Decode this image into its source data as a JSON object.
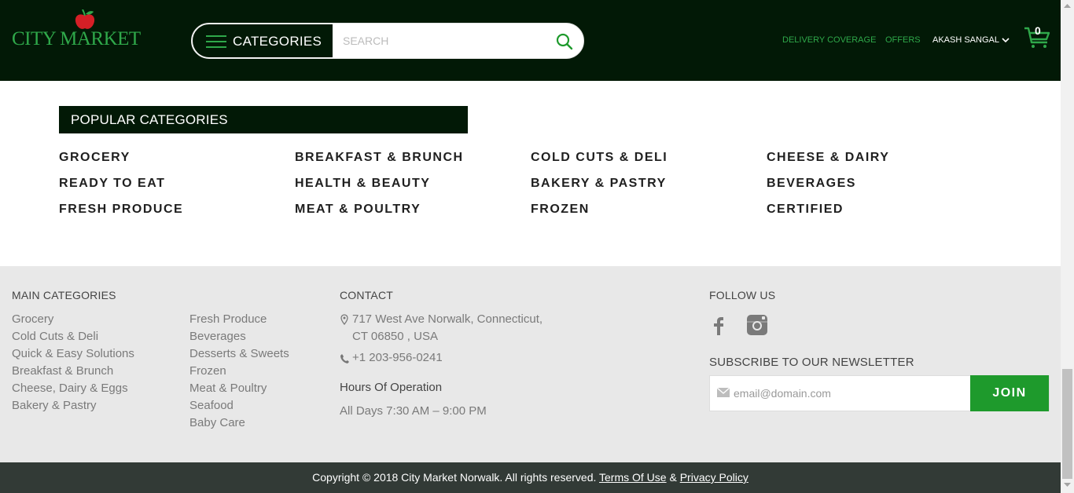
{
  "header": {
    "logo_text": "CITY MARKET",
    "categories_label": "CATEGORIES",
    "search_placeholder": "SEARCH",
    "nav": {
      "delivery": "DELIVERY COVERAGE",
      "offers": "OFFERS",
      "user": "AKASH SANGAL",
      "cart_count": "0"
    }
  },
  "popular": {
    "title": "POPULAR CATEGORIES",
    "columns": [
      [
        "GROCERY",
        "READY TO EAT",
        "FRESH PRODUCE"
      ],
      [
        "BREAKFAST & BRUNCH",
        "HEALTH & BEAUTY",
        "MEAT & POULTRY"
      ],
      [
        "COLD CUTS & DELI",
        "BAKERY & PASTRY",
        "FROZEN"
      ],
      [
        "CHEESE & DAIRY",
        "BEVERAGES",
        "CERTIFIED"
      ]
    ]
  },
  "footer": {
    "main_title": "MAIN CATEGORIES",
    "col1": [
      "Grocery",
      "Cold Cuts & Deli",
      "Quick & Easy Solutions",
      "Breakfast & Brunch",
      "Cheese, Dairy & Eggs",
      "Bakery & Pastry"
    ],
    "col2": [
      "Fresh Produce",
      "Beverages",
      "Desserts & Sweets",
      "Frozen",
      "Meat & Poultry",
      "Seafood",
      "Baby Care"
    ],
    "contact_title": "CONTACT",
    "address_line1": "717 West Ave Norwalk, Connecticut,",
    "address_line2": "CT 06850 , USA",
    "phone": "+1 203-956-0241",
    "hours_title": "Hours Of Operation",
    "hours": "All Days 7:30 AM – 9:00 PM",
    "follow_title": "FOLLOW US",
    "newsletter_title": "SUBSCRIBE TO OUR NEWSLETTER",
    "email_placeholder": "email@domain.com",
    "join_label": "JOIN"
  },
  "copyright": {
    "text": "Copyright © 2018 City Market Norwalk. All rights reserved.",
    "terms": "Terms Of Use",
    "amp": "&",
    "privacy": "Privacy Policy"
  },
  "colors": {
    "header_bg": "#021906",
    "brand_green": "#2fa84a",
    "join_green": "#1e9a2c",
    "footer_bg": "#e8e8e8",
    "copyright_bg": "#323a36"
  }
}
